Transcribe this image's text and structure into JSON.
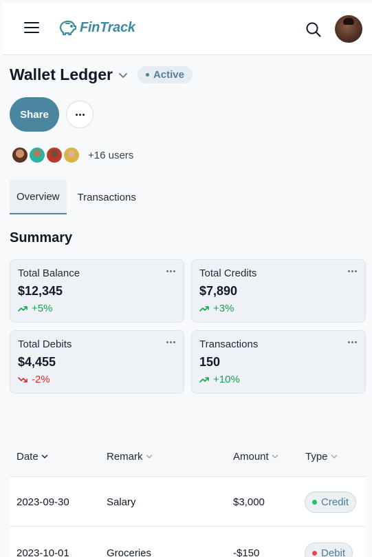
{
  "header": {
    "logo_text": "FinTrack",
    "brand_color": "#3e8a9c"
  },
  "page": {
    "title": "Wallet Ledger",
    "status": "Active",
    "share_label": "Share",
    "users_count": "+16 users"
  },
  "tabs": [
    {
      "label": "Overview",
      "active": true
    },
    {
      "label": "Transactions",
      "active": false
    }
  ],
  "summary": {
    "title": "Summary",
    "cards": [
      {
        "label": "Total Balance",
        "value": "$12,345",
        "trend": "+5%",
        "direction": "up"
      },
      {
        "label": "Total Credits",
        "value": "$7,890",
        "trend": "+3%",
        "direction": "up"
      },
      {
        "label": "Total Debits",
        "value": "$4,455",
        "trend": "-2%",
        "direction": "down"
      },
      {
        "label": "Transactions",
        "value": "150",
        "trend": "+10%",
        "direction": "up"
      }
    ]
  },
  "table": {
    "columns": [
      "Date",
      "Remark",
      "Amount",
      "Type"
    ],
    "rows": [
      {
        "date": "2023-09-30",
        "remark": "Salary",
        "amount": "$3,000",
        "type": "Credit",
        "type_color": "#22c55e"
      },
      {
        "date": "2023-10-01",
        "remark": "Groceries",
        "amount": "-$150",
        "type": "Debit",
        "type_color": "#ef4444"
      }
    ]
  },
  "colors": {
    "accent": "#4a86a0",
    "trend_up": "#16a34a",
    "trend_down": "#dc2626"
  }
}
